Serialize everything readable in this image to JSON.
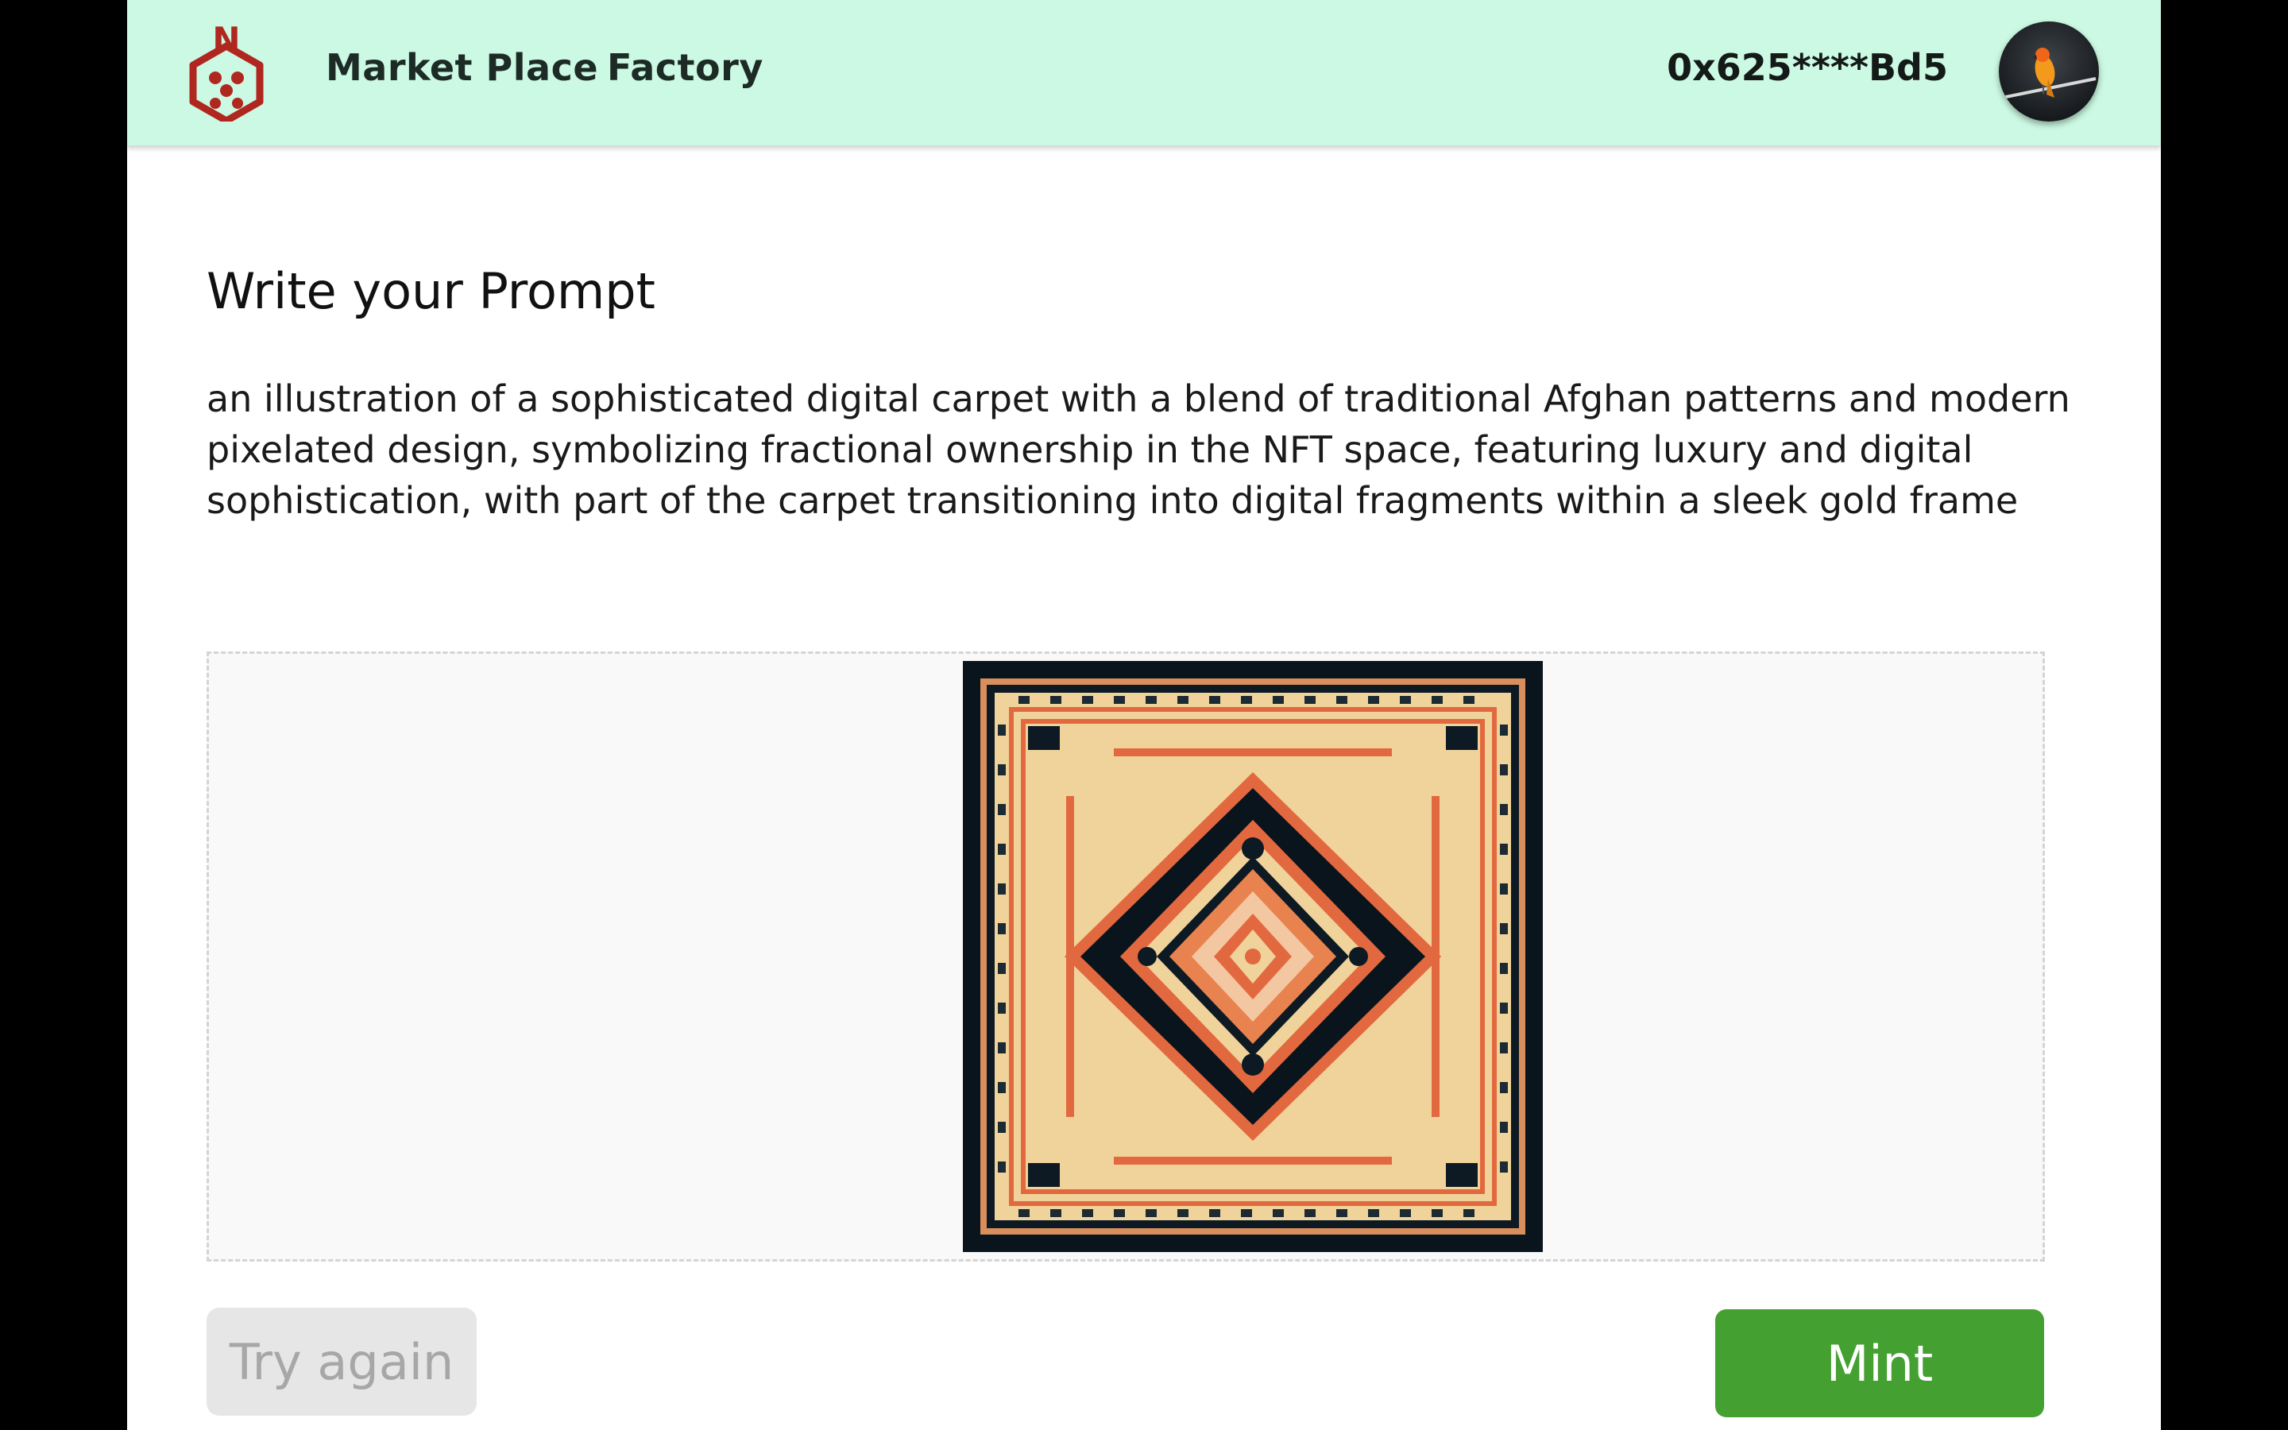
{
  "header": {
    "logo_letter": "N",
    "nav": {
      "market_place": "Market Place",
      "factory": "Factory"
    },
    "wallet_address": "0x625****Bd5"
  },
  "main": {
    "title": "Write your Prompt",
    "prompt": "an illustration of a sophisticated digital carpet with a blend of traditional Afghan patterns and modern pixelated design, symbolizing fractional ownership in the NFT space, featuring luxury and digital sophistication, with part of the carpet transitioning into digital fragments within a sleek gold frame"
  },
  "actions": {
    "try_again": "Try again",
    "mint": "Mint"
  },
  "colors": {
    "header_bg": "#ccf9e3",
    "logo_red": "#b0271f",
    "mint_green": "#45a032",
    "try_again_bg": "#e6e6e6",
    "carpet_navy": "#0a141d",
    "carpet_orange": "#e2693f",
    "carpet_beige": "#f0d39a"
  },
  "icons": {
    "logo": "hexagon-dice-logo-icon",
    "avatar": "parrot-avatar-icon"
  }
}
